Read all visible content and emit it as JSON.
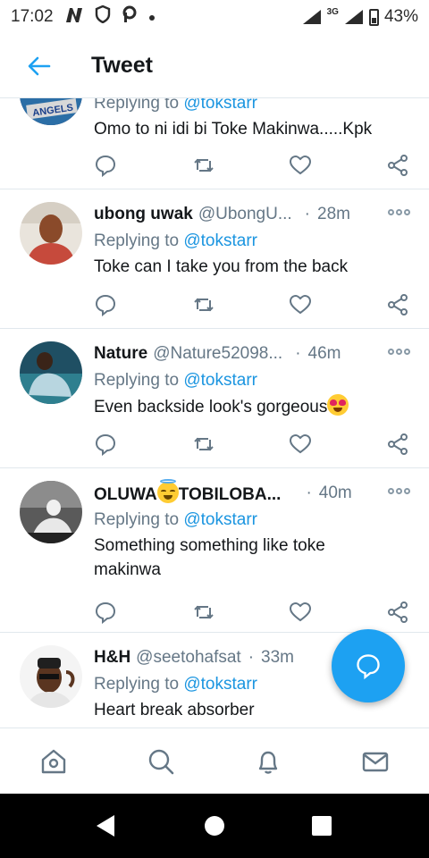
{
  "status_bar": {
    "time": "17:02",
    "network": "3G",
    "battery": "43%"
  },
  "header": {
    "title": "Tweet"
  },
  "tweets": [
    {
      "name": "",
      "handle": "",
      "time": "",
      "replying_label": "Replying to",
      "replying_to": "@tokstarr",
      "text": "Omo to ni idi bi Toke Makinwa.....Kpk"
    },
    {
      "name": "ubong uwak",
      "handle": "@UbongU...",
      "time": "28m",
      "replying_label": "Replying to",
      "replying_to": "@tokstarr",
      "text": "Toke can I take you from the back"
    },
    {
      "name": "Nature",
      "handle": "@Nature52098...",
      "time": "46m",
      "replying_label": "Replying to",
      "replying_to": "@tokstarr",
      "text": "Even backside look's gorgeous"
    },
    {
      "name_pre": "OLUWA",
      "name_post": "TOBILOBA...",
      "handle": "",
      "time": "40m",
      "replying_label": "Replying to",
      "replying_to": "@tokstarr",
      "text": "Something something like toke makinwa"
    },
    {
      "name": "H&H",
      "handle": "@seetohafsat",
      "time": "33m",
      "replying_label": "Replying to",
      "replying_to": "@tokstarr",
      "text": "Heart break absorber"
    }
  ],
  "colors": {
    "accent": "#1da1f2",
    "link": "#1b95e0",
    "secondary_text": "#657786",
    "divider": "#e1e8ed"
  }
}
